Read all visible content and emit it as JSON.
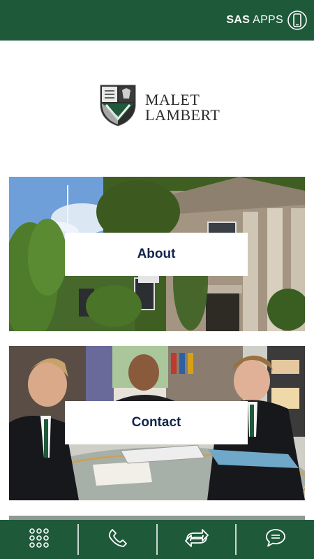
{
  "header": {
    "apps_brand": "SAS",
    "apps_label": "APPS",
    "phone_icon": "smartphone-icon"
  },
  "logo": {
    "line1": "MALET",
    "line2": "LAMBERT",
    "crest_icon": "school-crest-icon"
  },
  "tiles": [
    {
      "label": "About",
      "image": "ivy-covered-building-photo"
    },
    {
      "label": "Contact",
      "image": "students-in-library-photo"
    }
  ],
  "bottom_nav": [
    {
      "icon": "grid-dots-icon"
    },
    {
      "icon": "phone-icon"
    },
    {
      "icon": "refresh-arrows-icon"
    },
    {
      "icon": "chat-bubble-icon"
    }
  ],
  "colors": {
    "brand_green": "#1e5a3a",
    "button_text": "#13254a"
  }
}
